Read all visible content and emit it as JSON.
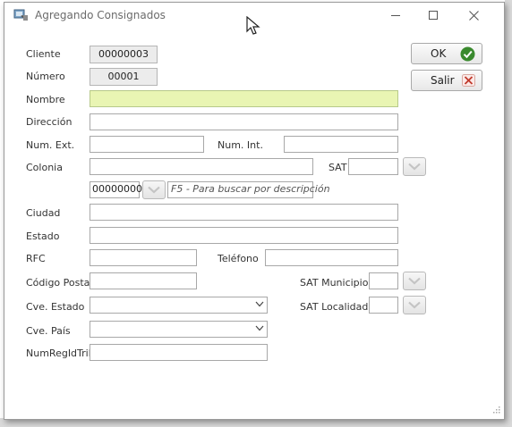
{
  "window": {
    "title": "Agregando Consignados",
    "controls": [
      "minimize-icon",
      "maximize-icon",
      "close-icon"
    ]
  },
  "form": {
    "cliente": {
      "label": "Cliente",
      "value": "00000003"
    },
    "numero": {
      "label": "Número",
      "value": "00001"
    },
    "nombre": {
      "label": "Nombre",
      "value": ""
    },
    "direccion": {
      "label": "Dirección",
      "value": ""
    },
    "num_ext": {
      "label": "Num. Ext.",
      "value": ""
    },
    "num_int": {
      "label": "Num. Int.",
      "value": ""
    },
    "colonia": {
      "label": "Colonia",
      "value": ""
    },
    "sat": {
      "label": "SAT",
      "value": ""
    },
    "colonia_code": {
      "value": "00000000",
      "hint": "F5 - Para buscar por descripción"
    },
    "ciudad": {
      "label": "Ciudad",
      "value": ""
    },
    "estado": {
      "label": "Estado",
      "value": ""
    },
    "rfc": {
      "label": "RFC",
      "value": ""
    },
    "telefono": {
      "label": "Teléfono",
      "value": ""
    },
    "codigo_postal": {
      "label": "Código Postal",
      "value": ""
    },
    "sat_municipio": {
      "label": "SAT Municipio",
      "value": ""
    },
    "cve_estado": {
      "label": "Cve. Estado",
      "value": ""
    },
    "sat_localidad": {
      "label": "SAT Localidad",
      "value": ""
    },
    "cve_pais": {
      "label": "Cve. País",
      "value": ""
    },
    "num_reg_id_trib": {
      "label": "NumRegIdTrib",
      "value": ""
    }
  },
  "buttons": {
    "ok": {
      "label": "OK",
      "icon": "check-circle-icon"
    },
    "salir": {
      "label": "Salir",
      "icon": "x-icon"
    }
  },
  "colors": {
    "highlight_field": "#e9f5b3",
    "ok_icon": "#3a8a2e",
    "salir_icon": "#c0392b"
  }
}
